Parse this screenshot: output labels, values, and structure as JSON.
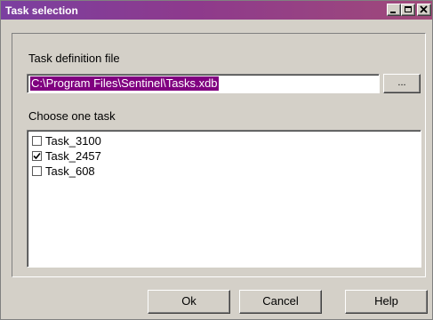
{
  "window": {
    "title": "Task selection",
    "colors": {
      "titlebar_start": "#7b3fa0",
      "titlebar_end": "#a04a7a",
      "face": "#d4d0c8",
      "selection": "#800080"
    }
  },
  "task_file": {
    "label": "Task definition file",
    "value": "C:\\Program Files\\Sentinel\\Tasks.xdb",
    "browse_label": "..."
  },
  "task_list": {
    "label": "Choose one task",
    "items": [
      {
        "label": "Task_3100",
        "checked": false
      },
      {
        "label": "Task_2457",
        "checked": true
      },
      {
        "label": "Task_608",
        "checked": false
      }
    ]
  },
  "buttons": {
    "ok": "Ok",
    "cancel": "Cancel",
    "help": "Help"
  }
}
